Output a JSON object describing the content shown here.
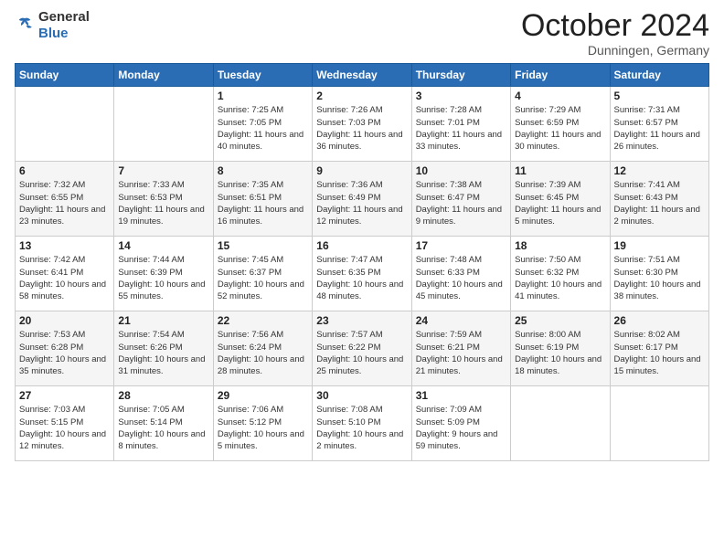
{
  "header": {
    "logo_general": "General",
    "logo_blue": "Blue",
    "month_title": "October 2024",
    "subtitle": "Dunningen, Germany"
  },
  "days_of_week": [
    "Sunday",
    "Monday",
    "Tuesday",
    "Wednesday",
    "Thursday",
    "Friday",
    "Saturday"
  ],
  "weeks": [
    [
      {
        "day": "",
        "info": ""
      },
      {
        "day": "",
        "info": ""
      },
      {
        "day": "1",
        "sunrise": "Sunrise: 7:25 AM",
        "sunset": "Sunset: 7:05 PM",
        "daylight": "Daylight: 11 hours and 40 minutes."
      },
      {
        "day": "2",
        "sunrise": "Sunrise: 7:26 AM",
        "sunset": "Sunset: 7:03 PM",
        "daylight": "Daylight: 11 hours and 36 minutes."
      },
      {
        "day": "3",
        "sunrise": "Sunrise: 7:28 AM",
        "sunset": "Sunset: 7:01 PM",
        "daylight": "Daylight: 11 hours and 33 minutes."
      },
      {
        "day": "4",
        "sunrise": "Sunrise: 7:29 AM",
        "sunset": "Sunset: 6:59 PM",
        "daylight": "Daylight: 11 hours and 30 minutes."
      },
      {
        "day": "5",
        "sunrise": "Sunrise: 7:31 AM",
        "sunset": "Sunset: 6:57 PM",
        "daylight": "Daylight: 11 hours and 26 minutes."
      }
    ],
    [
      {
        "day": "6",
        "sunrise": "Sunrise: 7:32 AM",
        "sunset": "Sunset: 6:55 PM",
        "daylight": "Daylight: 11 hours and 23 minutes."
      },
      {
        "day": "7",
        "sunrise": "Sunrise: 7:33 AM",
        "sunset": "Sunset: 6:53 PM",
        "daylight": "Daylight: 11 hours and 19 minutes."
      },
      {
        "day": "8",
        "sunrise": "Sunrise: 7:35 AM",
        "sunset": "Sunset: 6:51 PM",
        "daylight": "Daylight: 11 hours and 16 minutes."
      },
      {
        "day": "9",
        "sunrise": "Sunrise: 7:36 AM",
        "sunset": "Sunset: 6:49 PM",
        "daylight": "Daylight: 11 hours and 12 minutes."
      },
      {
        "day": "10",
        "sunrise": "Sunrise: 7:38 AM",
        "sunset": "Sunset: 6:47 PM",
        "daylight": "Daylight: 11 hours and 9 minutes."
      },
      {
        "day": "11",
        "sunrise": "Sunrise: 7:39 AM",
        "sunset": "Sunset: 6:45 PM",
        "daylight": "Daylight: 11 hours and 5 minutes."
      },
      {
        "day": "12",
        "sunrise": "Sunrise: 7:41 AM",
        "sunset": "Sunset: 6:43 PM",
        "daylight": "Daylight: 11 hours and 2 minutes."
      }
    ],
    [
      {
        "day": "13",
        "sunrise": "Sunrise: 7:42 AM",
        "sunset": "Sunset: 6:41 PM",
        "daylight": "Daylight: 10 hours and 58 minutes."
      },
      {
        "day": "14",
        "sunrise": "Sunrise: 7:44 AM",
        "sunset": "Sunset: 6:39 PM",
        "daylight": "Daylight: 10 hours and 55 minutes."
      },
      {
        "day": "15",
        "sunrise": "Sunrise: 7:45 AM",
        "sunset": "Sunset: 6:37 PM",
        "daylight": "Daylight: 10 hours and 52 minutes."
      },
      {
        "day": "16",
        "sunrise": "Sunrise: 7:47 AM",
        "sunset": "Sunset: 6:35 PM",
        "daylight": "Daylight: 10 hours and 48 minutes."
      },
      {
        "day": "17",
        "sunrise": "Sunrise: 7:48 AM",
        "sunset": "Sunset: 6:33 PM",
        "daylight": "Daylight: 10 hours and 45 minutes."
      },
      {
        "day": "18",
        "sunrise": "Sunrise: 7:50 AM",
        "sunset": "Sunset: 6:32 PM",
        "daylight": "Daylight: 10 hours and 41 minutes."
      },
      {
        "day": "19",
        "sunrise": "Sunrise: 7:51 AM",
        "sunset": "Sunset: 6:30 PM",
        "daylight": "Daylight: 10 hours and 38 minutes."
      }
    ],
    [
      {
        "day": "20",
        "sunrise": "Sunrise: 7:53 AM",
        "sunset": "Sunset: 6:28 PM",
        "daylight": "Daylight: 10 hours and 35 minutes."
      },
      {
        "day": "21",
        "sunrise": "Sunrise: 7:54 AM",
        "sunset": "Sunset: 6:26 PM",
        "daylight": "Daylight: 10 hours and 31 minutes."
      },
      {
        "day": "22",
        "sunrise": "Sunrise: 7:56 AM",
        "sunset": "Sunset: 6:24 PM",
        "daylight": "Daylight: 10 hours and 28 minutes."
      },
      {
        "day": "23",
        "sunrise": "Sunrise: 7:57 AM",
        "sunset": "Sunset: 6:22 PM",
        "daylight": "Daylight: 10 hours and 25 minutes."
      },
      {
        "day": "24",
        "sunrise": "Sunrise: 7:59 AM",
        "sunset": "Sunset: 6:21 PM",
        "daylight": "Daylight: 10 hours and 21 minutes."
      },
      {
        "day": "25",
        "sunrise": "Sunrise: 8:00 AM",
        "sunset": "Sunset: 6:19 PM",
        "daylight": "Daylight: 10 hours and 18 minutes."
      },
      {
        "day": "26",
        "sunrise": "Sunrise: 8:02 AM",
        "sunset": "Sunset: 6:17 PM",
        "daylight": "Daylight: 10 hours and 15 minutes."
      }
    ],
    [
      {
        "day": "27",
        "sunrise": "Sunrise: 7:03 AM",
        "sunset": "Sunset: 5:15 PM",
        "daylight": "Daylight: 10 hours and 12 minutes."
      },
      {
        "day": "28",
        "sunrise": "Sunrise: 7:05 AM",
        "sunset": "Sunset: 5:14 PM",
        "daylight": "Daylight: 10 hours and 8 minutes."
      },
      {
        "day": "29",
        "sunrise": "Sunrise: 7:06 AM",
        "sunset": "Sunset: 5:12 PM",
        "daylight": "Daylight: 10 hours and 5 minutes."
      },
      {
        "day": "30",
        "sunrise": "Sunrise: 7:08 AM",
        "sunset": "Sunset: 5:10 PM",
        "daylight": "Daylight: 10 hours and 2 minutes."
      },
      {
        "day": "31",
        "sunrise": "Sunrise: 7:09 AM",
        "sunset": "Sunset: 5:09 PM",
        "daylight": "Daylight: 9 hours and 59 minutes."
      },
      {
        "day": "",
        "info": ""
      },
      {
        "day": "",
        "info": ""
      }
    ]
  ]
}
